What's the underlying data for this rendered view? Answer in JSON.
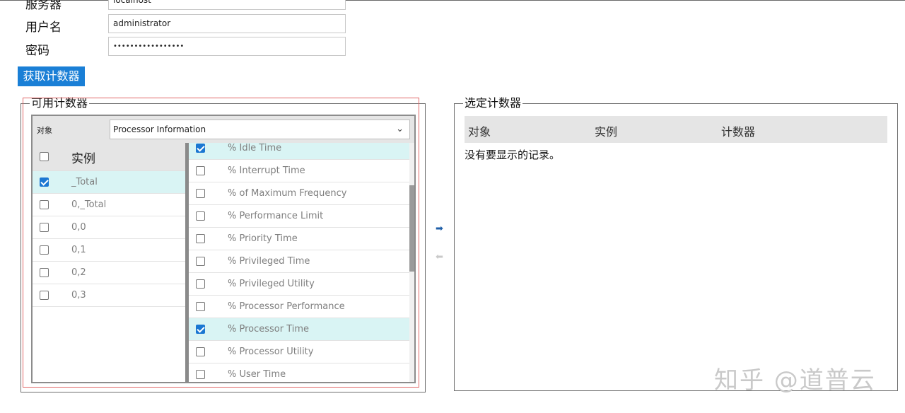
{
  "form": {
    "server_label": "服务器",
    "server_value": "localhost",
    "username_label": "用户名",
    "username_value": "administrator",
    "password_label": "密码",
    "password_value": "•••••••••••••••••",
    "fetch_button": "获取计数器"
  },
  "available": {
    "legend": "可用计数器",
    "object_label": "对象",
    "object_value": "Processor Information",
    "instance_header": "实例",
    "instances": [
      {
        "label": "_Total",
        "checked": true
      },
      {
        "label": "0,_Total",
        "checked": false
      },
      {
        "label": "0,0",
        "checked": false
      },
      {
        "label": "0,1",
        "checked": false
      },
      {
        "label": "0,2",
        "checked": false
      },
      {
        "label": "0,3",
        "checked": false
      }
    ],
    "counters": [
      {
        "label": "% Idle Time",
        "checked": true
      },
      {
        "label": "% Interrupt Time",
        "checked": false
      },
      {
        "label": "% of Maximum Frequency",
        "checked": false
      },
      {
        "label": "% Performance Limit",
        "checked": false
      },
      {
        "label": "% Priority Time",
        "checked": false
      },
      {
        "label": "% Privileged Time",
        "checked": false
      },
      {
        "label": "% Privileged Utility",
        "checked": false
      },
      {
        "label": "% Processor Performance",
        "checked": false
      },
      {
        "label": "% Processor Time",
        "checked": true
      },
      {
        "label": "% Processor Utility",
        "checked": false
      },
      {
        "label": "% User Time",
        "checked": false
      }
    ]
  },
  "selected": {
    "legend": "选定计数器",
    "col_object": "对象",
    "col_instance": "实例",
    "col_counter": "计数器",
    "empty_message": "没有要显示的记录。"
  },
  "icons": {
    "add": "arrow-right-icon",
    "remove": "arrow-left-icon"
  },
  "colors": {
    "accent": "#1a7fd6",
    "selected_row": "#d9f4f4",
    "highlight_frame": "#e06767"
  },
  "watermark": "知乎 @道普云"
}
